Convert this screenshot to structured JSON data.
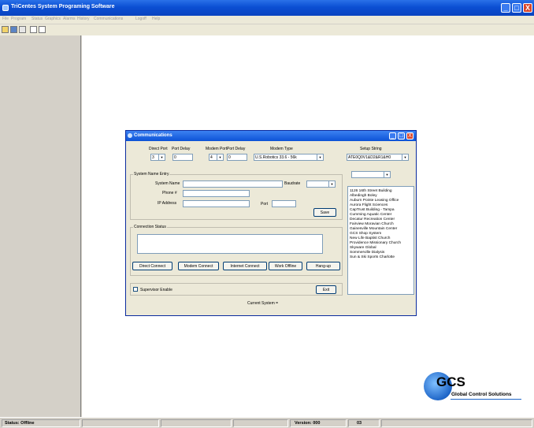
{
  "app": {
    "title": "TriCentes System Programing Software",
    "window_buttons": {
      "minimize": "_",
      "maximize": "□",
      "close": "X"
    }
  },
  "menu": [
    "File",
    "Program",
    "Status",
    "Graphics",
    "Alarms",
    "History",
    "Communications",
    "Logoff",
    "Help"
  ],
  "toolbar": {
    "icons": [
      "open-icon",
      "save-icon",
      "print-icon",
      "grid-icon",
      "grid2-icon"
    ]
  },
  "dialog": {
    "title": "Communications",
    "buttons": {
      "minimize": "_",
      "maximize": "□",
      "close": "X"
    },
    "direct_port_label": "Direct Port",
    "direct_port_value": "3",
    "port_delay_label": "Port Delay",
    "port_delay_value": "0",
    "modem_port_label": "Modem Port",
    "modem_port_value": "4",
    "modem_port_delay_label": "Port Delay",
    "modem_port_delay_value": "0",
    "modem_type_label": "Modem Type",
    "modem_type_value": "U.S.Robotics 33.6 - 56k",
    "setup_string_label": "Setup String",
    "setup_string_value": "ATE0Q0V1&D2&R1&H0",
    "system_name_entry": {
      "title": "System Name Entry",
      "system_name_label": "System Name",
      "system_name_value": "",
      "baudrate_label": "Baudrate",
      "baudrate_value": "",
      "phone_label": "Phone #",
      "phone_value": "",
      "ip_label": "IP Address",
      "ip_value": "",
      "port_label": "Port",
      "port_value": "",
      "save_label": "Save"
    },
    "system_select_value": "",
    "connection_status": {
      "title": "Connection Status",
      "text": ""
    },
    "action_buttons": [
      "Direct Connect",
      "Modem Connect",
      "Internet Connect",
      "Work Offline",
      "Hang-up"
    ],
    "supervisor_label": "Supervisor Enable",
    "exit_label": "Exit",
    "current_system_label": "Current System  =",
    "systems": [
      "1126 16th Street Building",
      "Albedingh Boley",
      "Auburn Pointe Leasing Office",
      "Aurora Flight Sciences",
      "CapTrust Building - Tampa",
      "Cumming Aquatic Center",
      "Decatur Recreation Center",
      "Fairview Moravian Church",
      "Gainesville Mountain Center",
      "GCS Shop System",
      "New Life Baptist Church",
      "Providence Missionary Church",
      "Skyware Global",
      "Sommerville Dialysis",
      "Sun & Ski Sports Charlotte"
    ]
  },
  "logo": {
    "name": "GCS",
    "subtitle": "Global Control Solutions"
  },
  "status": {
    "status_text": "Status: Offline",
    "version_text": "Version: 000",
    "code_text": "03"
  }
}
